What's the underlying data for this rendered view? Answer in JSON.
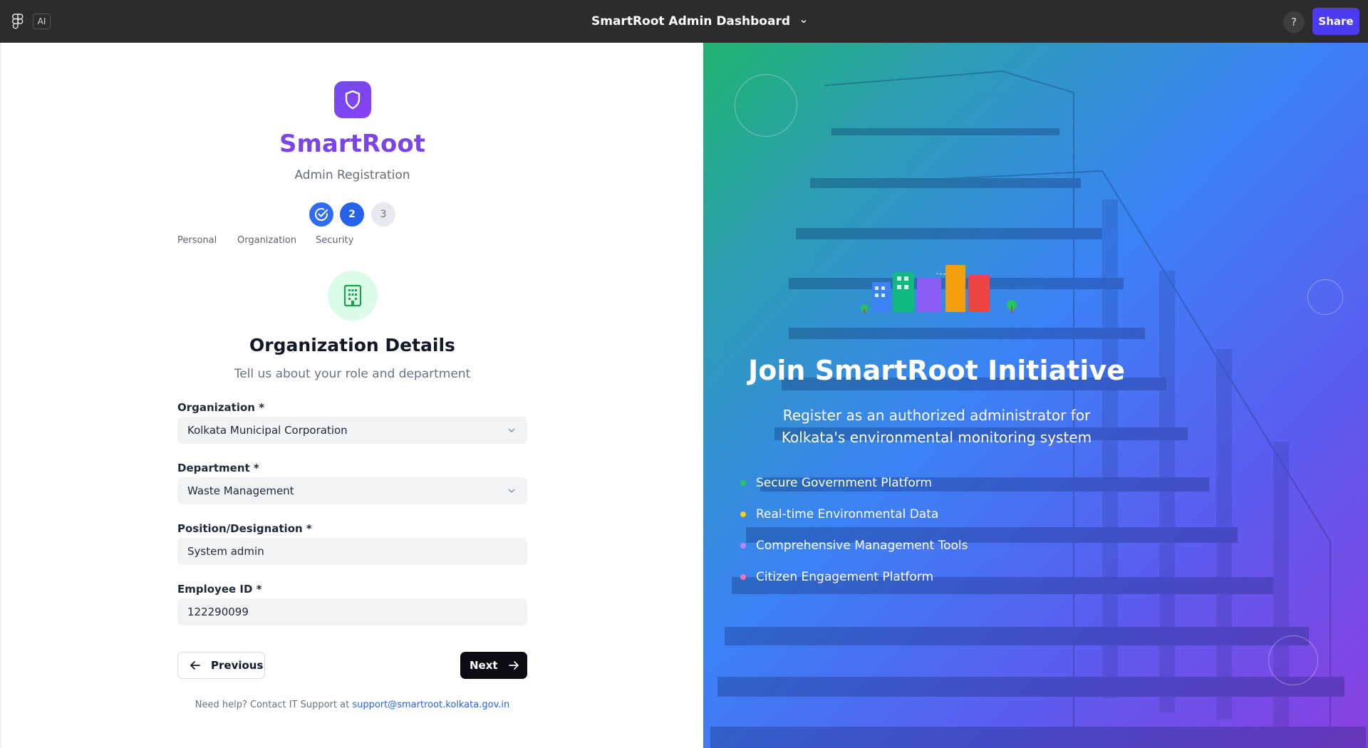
{
  "app": {
    "ai_label": "AI",
    "title": "SmartRoot Admin Dashboard",
    "help_label": "?",
    "share_label": "Share"
  },
  "brand": {
    "name": "SmartRoot",
    "subtitle": "Admin Registration"
  },
  "stepper": {
    "current_step": 2,
    "steps": [
      {
        "number": "1",
        "label": "Personal",
        "status": "completed"
      },
      {
        "number": "2",
        "label": "Organization",
        "status": "active"
      },
      {
        "number": "3",
        "label": "Security",
        "status": "pending"
      }
    ]
  },
  "section": {
    "title": "Organization Details",
    "subtitle": "Tell us about your role and department"
  },
  "form": {
    "organization": {
      "label": "Organization *",
      "value": "Kolkata Municipal Corporation"
    },
    "department": {
      "label": "Department *",
      "value": "Waste Management"
    },
    "position": {
      "label": "Position/Designation *",
      "value": "System admin"
    },
    "employee_id": {
      "label": "Employee ID *",
      "value": "122290099"
    }
  },
  "nav": {
    "previous_label": "Previous",
    "next_label": "Next"
  },
  "help": {
    "text": "Need help? Contact IT Support at ",
    "email": "support@smartroot.kolkata.gov.in"
  },
  "hero": {
    "title": "Join SmartRoot Initiative",
    "subtitle": "Register as an authorized administrator for Kolkata's environmental monitoring system",
    "features": [
      {
        "label": "Secure Government Platform",
        "color": "#22c55e"
      },
      {
        "label": "Real-time Environmental Data",
        "color": "#facc15"
      },
      {
        "label": "Comprehensive Management Tools",
        "color": "#c084fc"
      },
      {
        "label": "Citizen Engagement Platform",
        "color": "#f472b6"
      }
    ]
  },
  "colors": {
    "accent": "#4b3bf5",
    "brand_purple": "#7a45e8",
    "step_blue": "#2563eb"
  }
}
